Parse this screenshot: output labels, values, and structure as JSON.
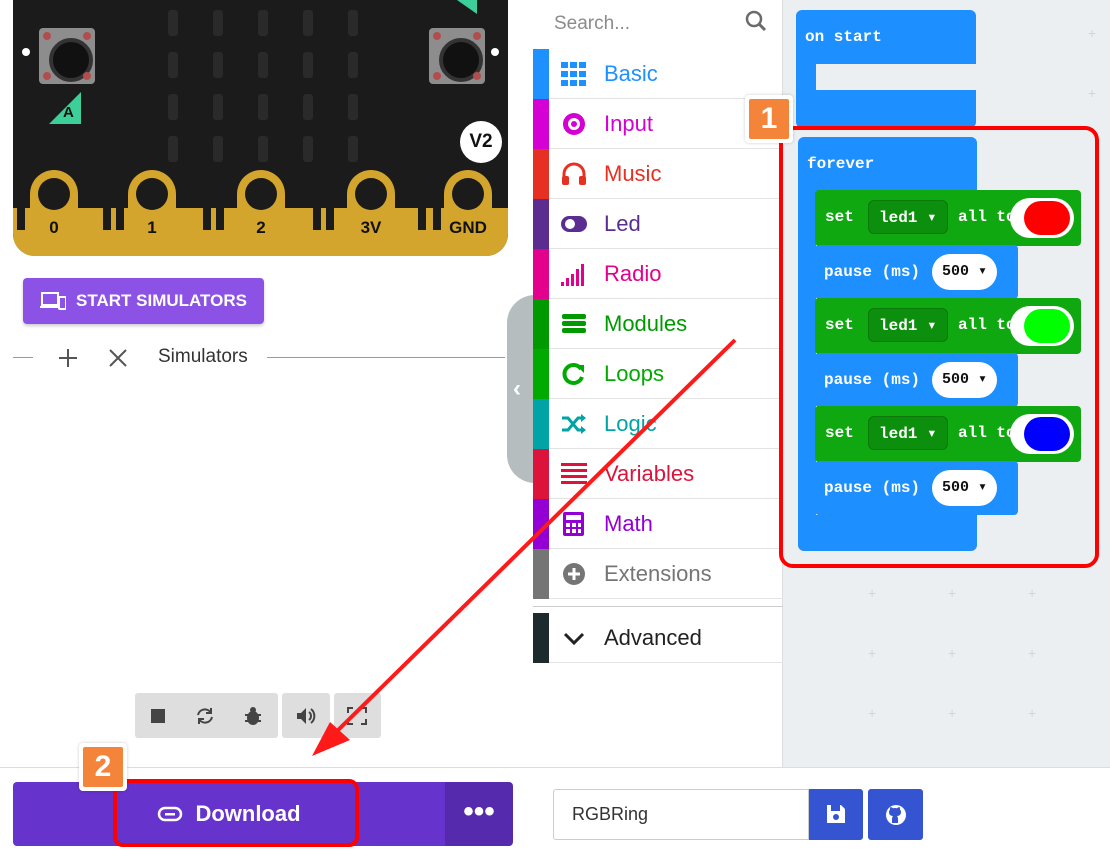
{
  "simulator": {
    "pins": [
      "0",
      "1",
      "2",
      "3V",
      "GND"
    ],
    "version_badge": "V2",
    "button_a_label": "A",
    "start_button": "START SIMULATORS",
    "section_label": "Simulators",
    "controls": [
      "stop-icon",
      "restart-icon",
      "debug-icon",
      "sound-icon",
      "fullscreen-icon"
    ]
  },
  "toolbox": {
    "search_placeholder": "Search...",
    "categories": [
      {
        "label": "Basic",
        "color": "#1e90ff",
        "icon": "grid-icon"
      },
      {
        "label": "Input",
        "color": "#d400d4",
        "icon": "target-icon"
      },
      {
        "label": "Music",
        "color": "#e63022",
        "icon": "headphones-icon"
      },
      {
        "label": "Led",
        "color": "#5c2d91",
        "icon": "toggle-icon"
      },
      {
        "label": "Radio",
        "color": "#e3008c",
        "icon": "signal-icon"
      },
      {
        "label": "Modules",
        "color": "#009900",
        "icon": "modules-icon"
      },
      {
        "label": "Loops",
        "color": "#00aa00",
        "icon": "loop-icon"
      },
      {
        "label": "Logic",
        "color": "#00a4a6",
        "icon": "shuffle-icon"
      },
      {
        "label": "Variables",
        "color": "#dc143c",
        "icon": "list-icon"
      },
      {
        "label": "Math",
        "color": "#9400d3",
        "icon": "calculator-icon"
      },
      {
        "label": "Extensions",
        "color": "#757575",
        "icon": "plus-circle-icon"
      }
    ],
    "advanced": "Advanced"
  },
  "workspace": {
    "on_start": "on start",
    "forever": "forever",
    "steps": [
      {
        "set": "set",
        "dropdown": "led1",
        "all_to": "all to",
        "color": "#ff0000",
        "pause": "pause (ms)",
        "value": "500"
      },
      {
        "set": "set",
        "dropdown": "led1",
        "all_to": "all to",
        "color": "#00ff00",
        "pause": "pause (ms)",
        "value": "500"
      },
      {
        "set": "set",
        "dropdown": "led1",
        "all_to": "all to",
        "color": "#0000ff",
        "pause": "pause (ms)",
        "value": "500"
      }
    ],
    "annotation_1": "1",
    "annotation_2": "2"
  },
  "bottom": {
    "download": "Download",
    "more": "•••",
    "project_name": "RGBRing"
  }
}
